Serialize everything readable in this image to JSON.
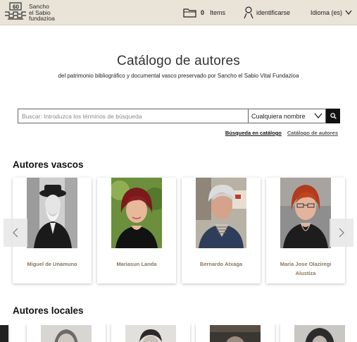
{
  "header": {
    "logo": {
      "line1": "Sancho",
      "line2": "el Sabio",
      "line3": "fundazioa",
      "badge": "60"
    },
    "items_count": "0",
    "items_label": "Items",
    "login_label": "identificarse",
    "language_label": "Idioma (es)"
  },
  "page": {
    "title": "Catálogo de autores",
    "subtitle": "del patrimonio bibliográfico y documental vasco preservado por Sancho el Sabio Vital Fundazioa"
  },
  "search": {
    "placeholder": "Buscar: Introduzca los términos de búsqueda",
    "select_value": "Cualquiera nombre"
  },
  "links": {
    "catalog_search": "Búsqueda en catálogo",
    "author_catalog": "Catálogo de autores"
  },
  "sections": {
    "basque_authors": "Autores vascos",
    "local_authors": "Autores locales"
  },
  "authors": [
    {
      "name": "Miguel de Unamuno"
    },
    {
      "name": "Mariasun Landa"
    },
    {
      "name": "Bernardo Atxaga"
    },
    {
      "name_line1": "María Jose Olaziregi",
      "name_line2": "Alustiza"
    }
  ],
  "colors": {
    "header_bg": "#e9e3d8",
    "author_name": "#8a7660",
    "search_button": "#111111"
  }
}
